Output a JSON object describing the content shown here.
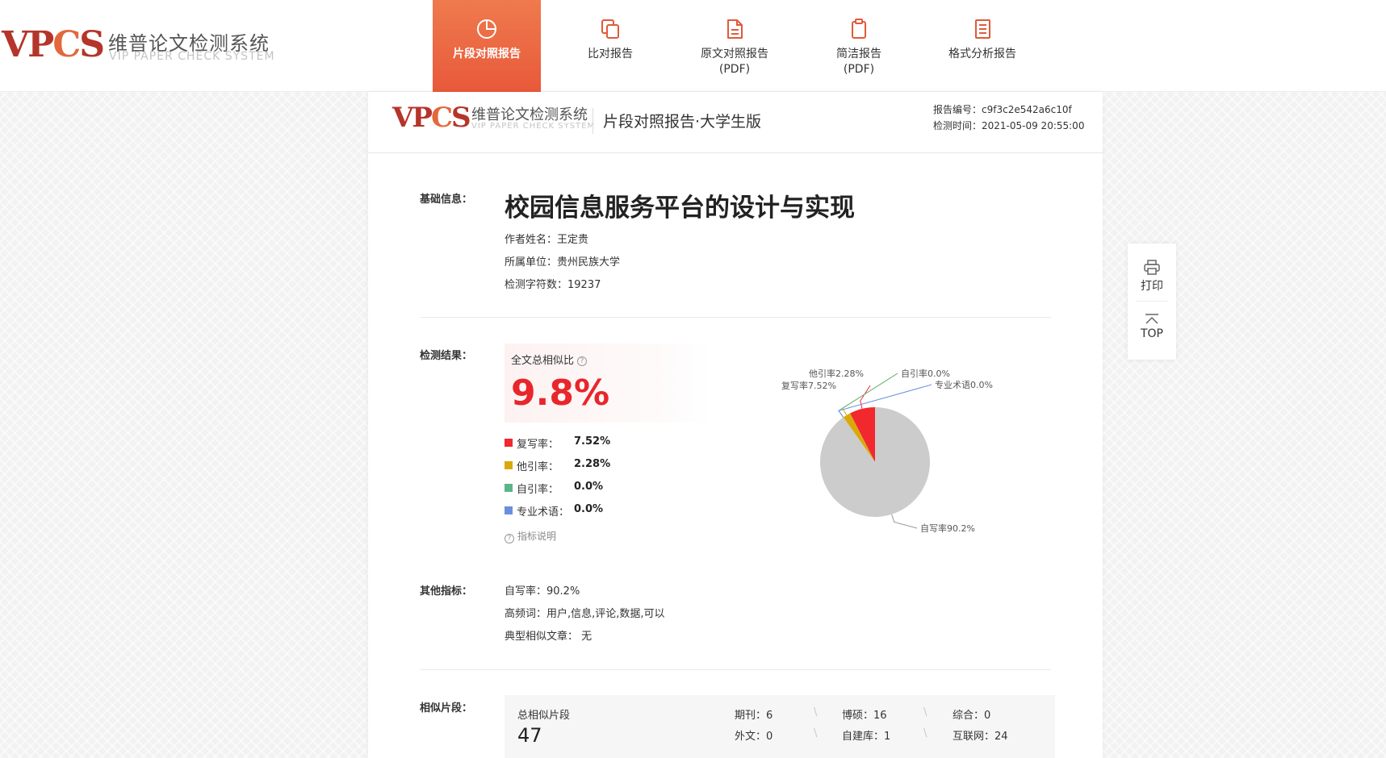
{
  "brand": {
    "logo_text": "VPCS",
    "name_cn": "维普论文检测系统",
    "name_en": "VIP PAPER CHECK SYSTEM"
  },
  "nav": {
    "items": [
      {
        "label": "片段对照报告",
        "label2": "",
        "icon": "pie-chart-icon",
        "active": true
      },
      {
        "label": "比对报告",
        "label2": "",
        "icon": "copy-icon",
        "active": false
      },
      {
        "label": "原文对照报告",
        "label2": "(PDF)",
        "icon": "document-icon",
        "active": false
      },
      {
        "label": "简洁报告",
        "label2": "(PDF)",
        "icon": "clipboard-icon",
        "active": false
      },
      {
        "label": "格式分析报告",
        "label2": "",
        "icon": "list-document-icon",
        "active": false
      }
    ]
  },
  "report_header": {
    "logo_text": "VPCS",
    "name_cn": "维普论文检测系统",
    "name_en": "VIP PAPER CHECK SYSTEM",
    "title": "片段对照报告·大学生版",
    "report_no": "报告编号：c9f3c2e542a6c10f",
    "check_time": "检测时间：2021-05-09 20:55:00"
  },
  "basic_info": {
    "label": "基础信息：",
    "title": "校园信息服务平台的设计与实现",
    "author": "作者姓名：王定贵",
    "affiliation": "所属单位：贵州民族大学",
    "char_count": "检测字符数：19237"
  },
  "result": {
    "label": "检测结果：",
    "total_label": "全文总相似比",
    "total_value": "9.8%",
    "items": [
      {
        "name": "复写率：",
        "value": "7.52%",
        "color": "#f1282d"
      },
      {
        "name": "他引率：",
        "value": "2.28%",
        "color": "#d9a90c"
      },
      {
        "name": "自引率：",
        "value": "0.0%",
        "color": "#5cb48a"
      },
      {
        "name": "专业术语：",
        "value": "0.0%",
        "color": "#6a8fe0"
      }
    ],
    "explain": "指标说明"
  },
  "chart_data": {
    "type": "pie",
    "slices": [
      {
        "label": "复写率7.52%",
        "value": 7.52,
        "color": "#f1282d"
      },
      {
        "label": "他引率2.28%",
        "value": 2.28,
        "color": "#d9a90c"
      },
      {
        "label": "自引率0.0%",
        "value": 0.0,
        "color": "#5cb48a"
      },
      {
        "label": "专业术语0.0%",
        "value": 0.0,
        "color": "#6a8fe0"
      },
      {
        "label": "自写率90.2%",
        "value": 90.2,
        "color": "#cccccc"
      }
    ]
  },
  "other": {
    "label": "其他指标：",
    "self_write": "自写率：90.2%",
    "keywords": "高频词：用户,信息,评论,数据,可以",
    "typical": "典型相似文章：  无"
  },
  "similar": {
    "label": "相似片段：",
    "total_label": "总相似片段",
    "total_value": "47",
    "stats": [
      "期刊：6",
      "博硕：16",
      "综合：0",
      "外文：0",
      "自建库：1",
      "互联网：24"
    ]
  },
  "sidetools": {
    "print": "打印",
    "top": "TOP"
  }
}
